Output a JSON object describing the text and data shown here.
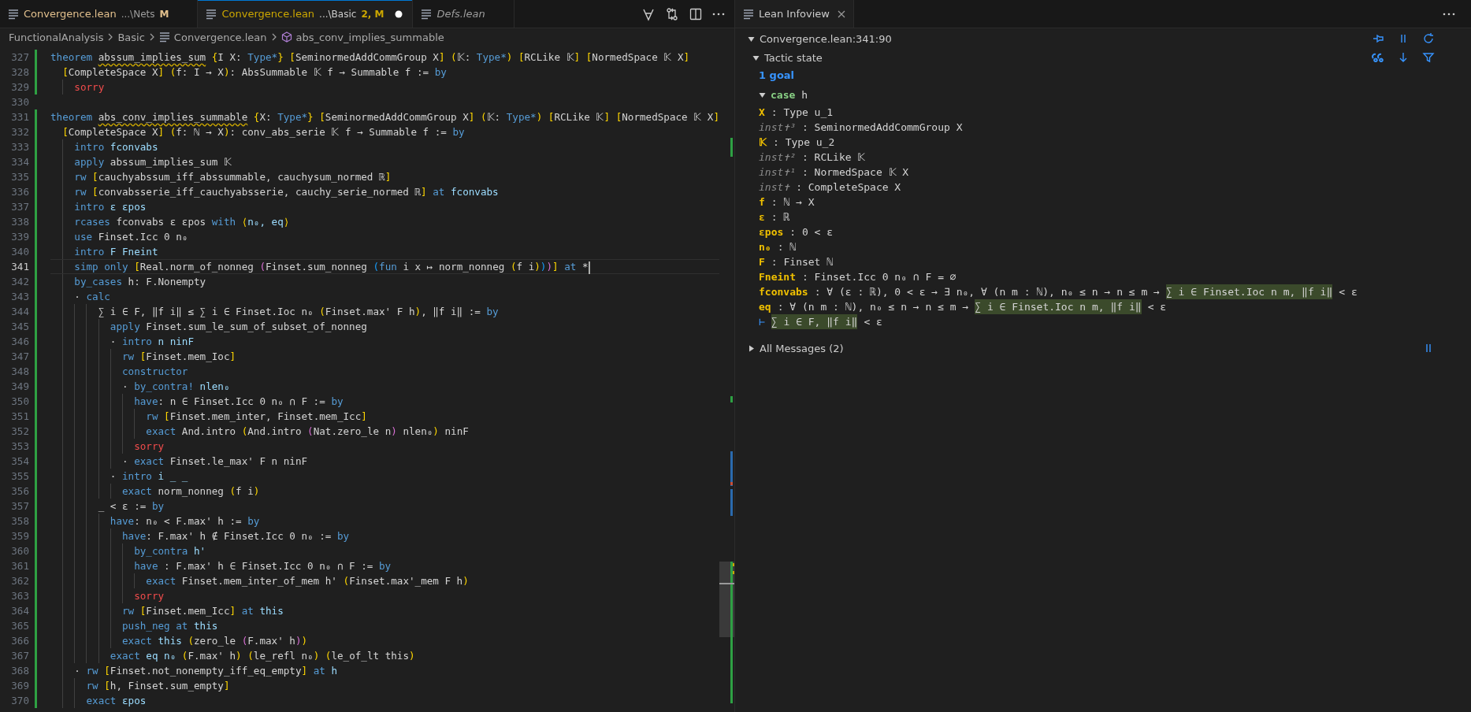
{
  "editor": {
    "tabs": [
      {
        "title": "Convergence.lean",
        "path": "...\\Nets",
        "badge": "M",
        "color": "#e2c08d",
        "selected": false,
        "dirty": false,
        "preview": false
      },
      {
        "title": "Convergence.lean",
        "path": "...\\Basic",
        "badge": "2, M",
        "color": "#cca700",
        "selected": true,
        "dirty": true,
        "preview": false
      },
      {
        "title": "Defs.lean",
        "selected": false,
        "dirty": false,
        "preview": true
      }
    ],
    "breadcrumbs": [
      {
        "text": "FunctionalAnalysis",
        "kind": "folder"
      },
      {
        "text": "Basic",
        "kind": "folder"
      },
      {
        "text": "Convergence.lean",
        "kind": "file"
      },
      {
        "text": "abs_conv_implies_summable",
        "kind": "symbol"
      }
    ],
    "lines": [
      {
        "number": "327",
        "changed": true,
        "current": false,
        "tokens": [
          {
            "kind": "kw",
            "text": "theorem "
          },
          {
            "kind": "warn",
            "text": "abssum_implies_sum"
          },
          {
            "kind": "b1",
            "text": " {"
          },
          {
            "kind": "txt",
            "text": "I X: "
          },
          {
            "kind": "kw",
            "text": "Type*"
          },
          {
            "kind": "b1",
            "text": "} ["
          },
          {
            "kind": "txt",
            "text": "SeminormedAddCommGroup X"
          },
          {
            "kind": "b1",
            "text": "] ("
          },
          {
            "kind": "txt",
            "text": "𝕂: "
          },
          {
            "kind": "kw",
            "text": "Type*"
          },
          {
            "kind": "b1",
            "text": ") ["
          },
          {
            "kind": "txt",
            "text": "RCLike 𝕂"
          },
          {
            "kind": "b1",
            "text": "] ["
          },
          {
            "kind": "txt",
            "text": "NormedSpace 𝕂 X"
          },
          {
            "kind": "b1",
            "text": "]"
          }
        ]
      },
      {
        "number": "328",
        "changed": true,
        "current": false,
        "tokens": [
          {
            "kind": "b1",
            "text": "  ["
          },
          {
            "kind": "txt",
            "text": "CompleteSpace X"
          },
          {
            "kind": "b1",
            "text": "] ("
          },
          {
            "kind": "txt",
            "text": "f: I → X"
          },
          {
            "kind": "b1",
            "text": ")"
          },
          {
            "kind": "txt",
            "text": ": AbsSummable 𝕂 f → Summable f := "
          },
          {
            "kind": "kw",
            "text": "by"
          }
        ]
      },
      {
        "number": "329",
        "changed": true,
        "current": false,
        "tokens": [
          {
            "kind": "err",
            "text": "    sorry"
          }
        ]
      },
      {
        "number": "330",
        "changed": false,
        "current": false
      },
      {
        "number": "331",
        "changed": true,
        "current": false,
        "tokens": [
          {
            "kind": "kw",
            "text": "theorem "
          },
          {
            "kind": "warn",
            "text": "abs_conv_implies_summable"
          },
          {
            "kind": "b1",
            "text": " {"
          },
          {
            "kind": "txt",
            "text": "X: "
          },
          {
            "kind": "kw",
            "text": "Type*"
          },
          {
            "kind": "b1",
            "text": "} ["
          },
          {
            "kind": "txt",
            "text": "SeminormedAddCommGroup X"
          },
          {
            "kind": "b1",
            "text": "] ("
          },
          {
            "kind": "txt",
            "text": "𝕂: "
          },
          {
            "kind": "kw",
            "text": "Type*"
          },
          {
            "kind": "b1",
            "text": ") ["
          },
          {
            "kind": "txt",
            "text": "RCLike 𝕂"
          },
          {
            "kind": "b1",
            "text": "] ["
          },
          {
            "kind": "txt",
            "text": "NormedSpace 𝕂 X"
          },
          {
            "kind": "b1",
            "text": "]"
          }
        ]
      },
      {
        "number": "332",
        "changed": true,
        "current": false,
        "tokens": [
          {
            "kind": "b1",
            "text": "  ["
          },
          {
            "kind": "txt",
            "text": "CompleteSpace X"
          },
          {
            "kind": "b1",
            "text": "] ("
          },
          {
            "kind": "txt",
            "text": "f: ℕ → X"
          },
          {
            "kind": "b1",
            "text": ")"
          },
          {
            "kind": "txt",
            "text": ": conv_abs_serie 𝕂 f → Summable f := "
          },
          {
            "kind": "kw",
            "text": "by"
          }
        ]
      },
      {
        "number": "333",
        "changed": true,
        "current": false,
        "tokens": [
          {
            "kind": "kw",
            "text": "    intro"
          },
          {
            "kind": "id",
            "text": " fconvabs"
          }
        ]
      },
      {
        "number": "334",
        "changed": true,
        "current": false,
        "tokens": [
          {
            "kind": "kw",
            "text": "    apply"
          },
          {
            "kind": "txt",
            "text": " abssum_implies_sum 𝕂"
          }
        ]
      },
      {
        "number": "335",
        "changed": true,
        "current": false,
        "tokens": [
          {
            "kind": "kw",
            "text": "    rw"
          },
          {
            "kind": "b1",
            "text": " ["
          },
          {
            "kind": "txt",
            "text": "cauchyabssum_iff_abssummable, cauchysum_normed ℝ"
          },
          {
            "kind": "b1",
            "text": "]"
          }
        ]
      },
      {
        "number": "336",
        "changed": true,
        "current": false,
        "tokens": [
          {
            "kind": "kw",
            "text": "    rw"
          },
          {
            "kind": "b1",
            "text": " ["
          },
          {
            "kind": "txt",
            "text": "convabsserie_iff_cauchyabsserie, cauchy_serie_normed ℝ"
          },
          {
            "kind": "b1",
            "text": "]"
          },
          {
            "kind": "kw",
            "text": " at"
          },
          {
            "kind": "id",
            "text": " fconvabs"
          }
        ]
      },
      {
        "number": "337",
        "changed": true,
        "current": false,
        "tokens": [
          {
            "kind": "kw",
            "text": "    intro"
          },
          {
            "kind": "id",
            "text": " ε εpos"
          }
        ]
      },
      {
        "number": "338",
        "changed": true,
        "current": false,
        "tokens": [
          {
            "kind": "kw",
            "text": "    rcases"
          },
          {
            "kind": "txt",
            "text": " fconvabs ε εpos "
          },
          {
            "kind": "kw",
            "text": "with"
          },
          {
            "kind": "b1",
            "text": " ⟨"
          },
          {
            "kind": "id",
            "text": "n₀, eq"
          },
          {
            "kind": "b1",
            "text": "⟩"
          }
        ]
      },
      {
        "number": "339",
        "changed": true,
        "current": false,
        "tokens": [
          {
            "kind": "kw",
            "text": "    use"
          },
          {
            "kind": "txt",
            "text": " Finset.Icc 0 n₀"
          }
        ]
      },
      {
        "number": "340",
        "changed": true,
        "current": false,
        "tokens": [
          {
            "kind": "kw",
            "text": "    intro"
          },
          {
            "kind": "id",
            "text": " F Fneint"
          }
        ]
      },
      {
        "number": "341",
        "changed": true,
        "current": true,
        "cursor": true,
        "tokens": [
          {
            "kind": "kw",
            "text": "    simp only"
          },
          {
            "kind": "b1",
            "text": " ["
          },
          {
            "kind": "txt",
            "text": "Real.norm_of_nonneg "
          },
          {
            "kind": "b2",
            "text": "("
          },
          {
            "kind": "txt",
            "text": "Finset.sum_nonneg "
          },
          {
            "kind": "b3",
            "text": "("
          },
          {
            "kind": "kw",
            "text": "fun"
          },
          {
            "kind": "txt",
            "text": " i x ↦ norm_nonneg "
          },
          {
            "kind": "b1",
            "text": "("
          },
          {
            "kind": "txt",
            "text": "f i"
          },
          {
            "kind": "b1",
            "text": ")"
          },
          {
            "kind": "b3",
            "text": ")"
          },
          {
            "kind": "b2",
            "text": ")"
          },
          {
            "kind": "b1",
            "text": "]"
          },
          {
            "kind": "kw",
            "text": " at"
          },
          {
            "kind": "txt",
            "text": " *"
          }
        ]
      },
      {
        "number": "342",
        "changed": true,
        "current": false,
        "tokens": [
          {
            "kind": "kw",
            "text": "    by_cases"
          },
          {
            "kind": "txt",
            "text": " h: F.Nonempty"
          }
        ]
      },
      {
        "number": "343",
        "changed": true,
        "current": false,
        "tokens": [
          {
            "kind": "txt",
            "text": "    · "
          },
          {
            "kind": "kw",
            "text": "calc"
          }
        ]
      },
      {
        "number": "344",
        "changed": true,
        "current": false,
        "tokens": [
          {
            "kind": "txt",
            "text": "        ∑ i ∈ F, ‖f i‖ ≤ ∑ i ∈ Finset.Ioc n₀ "
          },
          {
            "kind": "b1",
            "text": "("
          },
          {
            "kind": "txt",
            "text": "Finset.max' F h"
          },
          {
            "kind": "b1",
            "text": ")"
          },
          {
            "kind": "txt",
            "text": ", ‖f i‖ := "
          },
          {
            "kind": "kw",
            "text": "by"
          }
        ]
      },
      {
        "number": "345",
        "changed": true,
        "current": false,
        "tokens": [
          {
            "kind": "kw",
            "text": "          apply"
          },
          {
            "kind": "txt",
            "text": " Finset.sum_le_sum_of_subset_of_nonneg"
          }
        ]
      },
      {
        "number": "346",
        "changed": true,
        "current": false,
        "tokens": [
          {
            "kind": "txt",
            "text": "          · "
          },
          {
            "kind": "kw",
            "text": "intro"
          },
          {
            "kind": "id",
            "text": " n ninF"
          }
        ]
      },
      {
        "number": "347",
        "changed": true,
        "current": false,
        "tokens": [
          {
            "kind": "kw",
            "text": "            rw"
          },
          {
            "kind": "b1",
            "text": " ["
          },
          {
            "kind": "txt",
            "text": "Finset.mem_Ioc"
          },
          {
            "kind": "b1",
            "text": "]"
          }
        ]
      },
      {
        "number": "348",
        "changed": true,
        "current": false,
        "tokens": [
          {
            "kind": "kw",
            "text": "            constructor"
          }
        ]
      },
      {
        "number": "349",
        "changed": true,
        "current": false,
        "tokens": [
          {
            "kind": "txt",
            "text": "            · "
          },
          {
            "kind": "kw",
            "text": "by_contra!"
          },
          {
            "kind": "id",
            "text": " nlen₀"
          }
        ]
      },
      {
        "number": "350",
        "changed": true,
        "current": false,
        "tokens": [
          {
            "kind": "kw",
            "text": "              have"
          },
          {
            "kind": "txt",
            "text": ": n ∈ Finset.Icc 0 n₀ ∩ F := "
          },
          {
            "kind": "kw",
            "text": "by"
          }
        ]
      },
      {
        "number": "351",
        "changed": true,
        "current": false,
        "tokens": [
          {
            "kind": "kw",
            "text": "                rw"
          },
          {
            "kind": "b1",
            "text": " ["
          },
          {
            "kind": "txt",
            "text": "Finset.mem_inter, Finset.mem_Icc"
          },
          {
            "kind": "b1",
            "text": "]"
          }
        ]
      },
      {
        "number": "352",
        "changed": true,
        "current": false,
        "tokens": [
          {
            "kind": "kw",
            "text": "                exact"
          },
          {
            "kind": "txt",
            "text": " And.intro "
          },
          {
            "kind": "b1",
            "text": "("
          },
          {
            "kind": "txt",
            "text": "And.intro "
          },
          {
            "kind": "b2",
            "text": "("
          },
          {
            "kind": "txt",
            "text": "Nat.zero_le n"
          },
          {
            "kind": "b2",
            "text": ")"
          },
          {
            "kind": "txt",
            "text": " nlen₀"
          },
          {
            "kind": "b1",
            "text": ")"
          },
          {
            "kind": "txt",
            "text": " ninF"
          }
        ]
      },
      {
        "number": "353",
        "changed": true,
        "current": false,
        "tokens": [
          {
            "kind": "err",
            "text": "              sorry"
          }
        ]
      },
      {
        "number": "354",
        "changed": true,
        "current": false,
        "tokens": [
          {
            "kind": "txt",
            "text": "            · "
          },
          {
            "kind": "kw",
            "text": "exact"
          },
          {
            "kind": "txt",
            "text": " Finset.le_max' F n ninF"
          }
        ]
      },
      {
        "number": "355",
        "changed": true,
        "current": false,
        "tokens": [
          {
            "kind": "txt",
            "text": "          · "
          },
          {
            "kind": "kw",
            "text": "intro"
          },
          {
            "kind": "id",
            "text": " i _ _"
          }
        ]
      },
      {
        "number": "356",
        "changed": true,
        "current": false,
        "tokens": [
          {
            "kind": "kw",
            "text": "            exact"
          },
          {
            "kind": "txt",
            "text": " norm_nonneg "
          },
          {
            "kind": "b1",
            "text": "("
          },
          {
            "kind": "txt",
            "text": "f i"
          },
          {
            "kind": "b1",
            "text": ")"
          }
        ]
      },
      {
        "number": "357",
        "changed": true,
        "current": false,
        "tokens": [
          {
            "kind": "txt",
            "text": "        _ < ε := "
          },
          {
            "kind": "kw",
            "text": "by"
          }
        ]
      },
      {
        "number": "358",
        "changed": true,
        "current": false,
        "tokens": [
          {
            "kind": "kw",
            "text": "          have"
          },
          {
            "kind": "txt",
            "text": ": n₀ < F.max' h := "
          },
          {
            "kind": "kw",
            "text": "by"
          }
        ]
      },
      {
        "number": "359",
        "changed": true,
        "current": false,
        "tokens": [
          {
            "kind": "kw",
            "text": "            have"
          },
          {
            "kind": "txt",
            "text": ": F.max' h ∉ Finset.Icc 0 n₀ := "
          },
          {
            "kind": "kw",
            "text": "by"
          }
        ]
      },
      {
        "number": "360",
        "changed": true,
        "current": false,
        "tokens": [
          {
            "kind": "kw",
            "text": "              by_contra"
          },
          {
            "kind": "id",
            "text": " h'"
          }
        ]
      },
      {
        "number": "361",
        "changed": true,
        "current": false,
        "tokens": [
          {
            "kind": "kw",
            "text": "              have"
          },
          {
            "kind": "txt",
            "text": " : F.max' h ∈ Finset.Icc 0 n₀ ∩ F := "
          },
          {
            "kind": "kw",
            "text": "by"
          }
        ]
      },
      {
        "number": "362",
        "changed": true,
        "current": false,
        "tokens": [
          {
            "kind": "kw",
            "text": "                exact"
          },
          {
            "kind": "txt",
            "text": " Finset.mem_inter_of_mem h' "
          },
          {
            "kind": "b1",
            "text": "("
          },
          {
            "kind": "txt",
            "text": "Finset.max'_mem F h"
          },
          {
            "kind": "b1",
            "text": ")"
          }
        ]
      },
      {
        "number": "363",
        "changed": true,
        "current": false,
        "tokens": [
          {
            "kind": "err",
            "text": "              sorry"
          }
        ]
      },
      {
        "number": "364",
        "changed": true,
        "current": false,
        "tokens": [
          {
            "kind": "kw",
            "text": "            rw"
          },
          {
            "kind": "b1",
            "text": " ["
          },
          {
            "kind": "txt",
            "text": "Finset.mem_Icc"
          },
          {
            "kind": "b1",
            "text": "]"
          },
          {
            "kind": "kw",
            "text": " at"
          },
          {
            "kind": "id",
            "text": " this"
          }
        ]
      },
      {
        "number": "365",
        "changed": true,
        "current": false,
        "tokens": [
          {
            "kind": "kw",
            "text": "            push_neg at"
          },
          {
            "kind": "id",
            "text": " this"
          }
        ]
      },
      {
        "number": "366",
        "changed": true,
        "current": false,
        "tokens": [
          {
            "kind": "kw",
            "text": "            exact"
          },
          {
            "kind": "id",
            "text": " this "
          },
          {
            "kind": "b1",
            "text": "("
          },
          {
            "kind": "txt",
            "text": "zero_le "
          },
          {
            "kind": "b2",
            "text": "("
          },
          {
            "kind": "txt",
            "text": "F.max' h"
          },
          {
            "kind": "b2",
            "text": ")"
          },
          {
            "kind": "b1",
            "text": ")"
          }
        ]
      },
      {
        "number": "367",
        "changed": true,
        "current": false,
        "tokens": [
          {
            "kind": "kw",
            "text": "          exact"
          },
          {
            "kind": "id",
            "text": " eq n₀ "
          },
          {
            "kind": "b1",
            "text": "("
          },
          {
            "kind": "txt",
            "text": "F.max' h"
          },
          {
            "kind": "b1",
            "text": ") ("
          },
          {
            "kind": "txt",
            "text": "le_refl n₀"
          },
          {
            "kind": "b1",
            "text": ") ("
          },
          {
            "kind": "txt",
            "text": "le_of_lt this"
          },
          {
            "kind": "b1",
            "text": ")"
          }
        ]
      },
      {
        "number": "368",
        "changed": true,
        "current": false,
        "tokens": [
          {
            "kind": "txt",
            "text": "    · "
          },
          {
            "kind": "kw",
            "text": "rw"
          },
          {
            "kind": "b1",
            "text": " ["
          },
          {
            "kind": "txt",
            "text": "Finset.not_nonempty_iff_eq_empty"
          },
          {
            "kind": "b1",
            "text": "]"
          },
          {
            "kind": "kw",
            "text": " at"
          },
          {
            "kind": "id",
            "text": " h"
          }
        ]
      },
      {
        "number": "369",
        "changed": true,
        "current": false,
        "tokens": [
          {
            "kind": "kw",
            "text": "      rw"
          },
          {
            "kind": "b1",
            "text": " ["
          },
          {
            "kind": "txt",
            "text": "h, Finset.sum_empty"
          },
          {
            "kind": "b1",
            "text": "]"
          }
        ]
      },
      {
        "number": "370",
        "changed": true,
        "current": false,
        "tokens": [
          {
            "kind": "kw",
            "text": "      exact"
          },
          {
            "kind": "id",
            "text": " εpos"
          }
        ]
      }
    ]
  },
  "infoview": {
    "tab": {
      "title": "Lean Infoview"
    },
    "position": {
      "label": "Convergence.lean:341:90",
      "expanded": true
    },
    "tactic_state": {
      "label": "Tactic state",
      "expanded": true
    },
    "goal_count": "1 goal",
    "case": {
      "keyword": "case",
      "name": "h",
      "expanded": true
    },
    "hypotheses": [
      {
        "name": "X",
        "kind": "var",
        "segments": [
          {
            "text": ": Type u_1",
            "highlight": false
          }
        ]
      },
      {
        "name": "inst✝³",
        "kind": "inst",
        "segments": [
          {
            "text": ": SeminormedAddCommGroup X",
            "highlight": false
          }
        ]
      },
      {
        "name": "𝕂",
        "kind": "var",
        "segments": [
          {
            "text": ": Type u_2",
            "highlight": false
          }
        ]
      },
      {
        "name": "inst✝²",
        "kind": "inst",
        "segments": [
          {
            "text": ": RCLike 𝕂",
            "highlight": false
          }
        ]
      },
      {
        "name": "inst✝¹",
        "kind": "inst",
        "segments": [
          {
            "text": ": NormedSpace 𝕂 X",
            "highlight": false
          }
        ]
      },
      {
        "name": "inst✝",
        "kind": "inst",
        "segments": [
          {
            "text": ": CompleteSpace X",
            "highlight": false
          }
        ]
      },
      {
        "name": "f",
        "kind": "var",
        "segments": [
          {
            "text": ": ℕ → X",
            "highlight": false
          }
        ]
      },
      {
        "name": "ε",
        "kind": "var",
        "segments": [
          {
            "text": ": ℝ",
            "highlight": false
          }
        ]
      },
      {
        "name": "εpos",
        "kind": "var",
        "segments": [
          {
            "text": ": 0 < ε",
            "highlight": false
          }
        ]
      },
      {
        "name": "n₀",
        "kind": "var",
        "segments": [
          {
            "text": ": ℕ",
            "highlight": false
          }
        ]
      },
      {
        "name": "F",
        "kind": "var",
        "segments": [
          {
            "text": ": Finset ℕ",
            "highlight": false
          }
        ]
      },
      {
        "name": "Fneint",
        "kind": "var",
        "segments": [
          {
            "text": ": Finset.Icc 0 n₀ ∩ F = ∅",
            "highlight": false
          }
        ]
      },
      {
        "name": "fconvabs",
        "kind": "var",
        "segments": [
          {
            "text": ": ∀ (ε : ℝ), 0 < ε → ∃ n₀, ∀ (n m : ℕ), n₀ ≤ n → n ≤ m →",
            "highlight": false
          },
          {
            "text": "∑ i ∈ Finset.Ioc n m, ‖f i‖",
            "highlight": true
          },
          {
            "text": "< ε",
            "highlight": false
          }
        ]
      },
      {
        "name": "eq",
        "kind": "var",
        "segments": [
          {
            "text": ": ∀ (n m : ℕ), n₀ ≤ n → n ≤ m →",
            "highlight": false
          },
          {
            "text": "∑ i ∈ Finset.Ioc n m, ‖f i‖",
            "highlight": true
          },
          {
            "text": "< ε",
            "highlight": false
          }
        ]
      }
    ],
    "goal": {
      "symbol": "⊢",
      "segments": [
        {
          "text": "∑ i ∈ F, ‖f i‖",
          "highlight": true
        },
        {
          "text": "< ε",
          "highlight": false
        }
      ]
    },
    "all_messages": {
      "label": "All Messages (2)",
      "expanded": false
    }
  }
}
